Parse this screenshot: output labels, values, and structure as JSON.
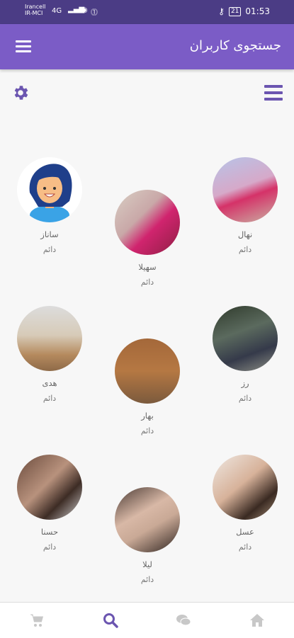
{
  "status_bar": {
    "carrier_line1": "Irancell",
    "carrier_line2": "IR-MCI",
    "network": "4G",
    "battery": "21",
    "time": "01:53"
  },
  "header": {
    "title": "جستجوی کاربران"
  },
  "users": [
    {
      "name": "ساناز",
      "status": "دائم"
    },
    {
      "name": "سهیلا",
      "status": "دائم"
    },
    {
      "name": "نهال",
      "status": "دائم"
    },
    {
      "name": "هدی",
      "status": "دائم"
    },
    {
      "name": "بهار",
      "status": "دائم"
    },
    {
      "name": "رز",
      "status": "دائم"
    },
    {
      "name": "حسنا",
      "status": "دائم"
    },
    {
      "name": "لیلا",
      "status": "دائم"
    },
    {
      "name": "عسل",
      "status": "دائم"
    }
  ],
  "bottom_nav": {
    "items": [
      {
        "icon": "cart-icon"
      },
      {
        "icon": "search-icon",
        "active": true
      },
      {
        "icon": "chat-icon"
      },
      {
        "icon": "home-icon"
      }
    ]
  },
  "colors": {
    "primary": "#7b5cc6",
    "status_bar": "#4b3c85",
    "active_icon": "#6b55b0",
    "inactive_icon": "#c8c8c8"
  }
}
